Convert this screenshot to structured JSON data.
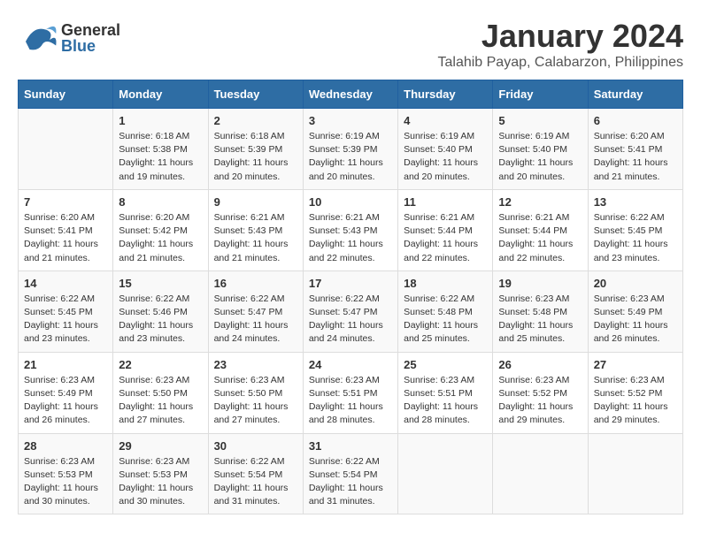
{
  "header": {
    "logo_general": "General",
    "logo_blue": "Blue",
    "title": "January 2024",
    "subtitle": "Talahib Payap, Calabarzon, Philippines"
  },
  "days_of_week": [
    "Sunday",
    "Monday",
    "Tuesday",
    "Wednesday",
    "Thursday",
    "Friday",
    "Saturday"
  ],
  "weeks": [
    [
      {
        "day": "",
        "info": ""
      },
      {
        "day": "1",
        "info": "Sunrise: 6:18 AM\nSunset: 5:38 PM\nDaylight: 11 hours\nand 19 minutes."
      },
      {
        "day": "2",
        "info": "Sunrise: 6:18 AM\nSunset: 5:39 PM\nDaylight: 11 hours\nand 20 minutes."
      },
      {
        "day": "3",
        "info": "Sunrise: 6:19 AM\nSunset: 5:39 PM\nDaylight: 11 hours\nand 20 minutes."
      },
      {
        "day": "4",
        "info": "Sunrise: 6:19 AM\nSunset: 5:40 PM\nDaylight: 11 hours\nand 20 minutes."
      },
      {
        "day": "5",
        "info": "Sunrise: 6:19 AM\nSunset: 5:40 PM\nDaylight: 11 hours\nand 20 minutes."
      },
      {
        "day": "6",
        "info": "Sunrise: 6:20 AM\nSunset: 5:41 PM\nDaylight: 11 hours\nand 21 minutes."
      }
    ],
    [
      {
        "day": "7",
        "info": "Sunrise: 6:20 AM\nSunset: 5:41 PM\nDaylight: 11 hours\nand 21 minutes."
      },
      {
        "day": "8",
        "info": "Sunrise: 6:20 AM\nSunset: 5:42 PM\nDaylight: 11 hours\nand 21 minutes."
      },
      {
        "day": "9",
        "info": "Sunrise: 6:21 AM\nSunset: 5:43 PM\nDaylight: 11 hours\nand 21 minutes."
      },
      {
        "day": "10",
        "info": "Sunrise: 6:21 AM\nSunset: 5:43 PM\nDaylight: 11 hours\nand 22 minutes."
      },
      {
        "day": "11",
        "info": "Sunrise: 6:21 AM\nSunset: 5:44 PM\nDaylight: 11 hours\nand 22 minutes."
      },
      {
        "day": "12",
        "info": "Sunrise: 6:21 AM\nSunset: 5:44 PM\nDaylight: 11 hours\nand 22 minutes."
      },
      {
        "day": "13",
        "info": "Sunrise: 6:22 AM\nSunset: 5:45 PM\nDaylight: 11 hours\nand 23 minutes."
      }
    ],
    [
      {
        "day": "14",
        "info": "Sunrise: 6:22 AM\nSunset: 5:45 PM\nDaylight: 11 hours\nand 23 minutes."
      },
      {
        "day": "15",
        "info": "Sunrise: 6:22 AM\nSunset: 5:46 PM\nDaylight: 11 hours\nand 23 minutes."
      },
      {
        "day": "16",
        "info": "Sunrise: 6:22 AM\nSunset: 5:47 PM\nDaylight: 11 hours\nand 24 minutes."
      },
      {
        "day": "17",
        "info": "Sunrise: 6:22 AM\nSunset: 5:47 PM\nDaylight: 11 hours\nand 24 minutes."
      },
      {
        "day": "18",
        "info": "Sunrise: 6:22 AM\nSunset: 5:48 PM\nDaylight: 11 hours\nand 25 minutes."
      },
      {
        "day": "19",
        "info": "Sunrise: 6:23 AM\nSunset: 5:48 PM\nDaylight: 11 hours\nand 25 minutes."
      },
      {
        "day": "20",
        "info": "Sunrise: 6:23 AM\nSunset: 5:49 PM\nDaylight: 11 hours\nand 26 minutes."
      }
    ],
    [
      {
        "day": "21",
        "info": "Sunrise: 6:23 AM\nSunset: 5:49 PM\nDaylight: 11 hours\nand 26 minutes."
      },
      {
        "day": "22",
        "info": "Sunrise: 6:23 AM\nSunset: 5:50 PM\nDaylight: 11 hours\nand 27 minutes."
      },
      {
        "day": "23",
        "info": "Sunrise: 6:23 AM\nSunset: 5:50 PM\nDaylight: 11 hours\nand 27 minutes."
      },
      {
        "day": "24",
        "info": "Sunrise: 6:23 AM\nSunset: 5:51 PM\nDaylight: 11 hours\nand 28 minutes."
      },
      {
        "day": "25",
        "info": "Sunrise: 6:23 AM\nSunset: 5:51 PM\nDaylight: 11 hours\nand 28 minutes."
      },
      {
        "day": "26",
        "info": "Sunrise: 6:23 AM\nSunset: 5:52 PM\nDaylight: 11 hours\nand 29 minutes."
      },
      {
        "day": "27",
        "info": "Sunrise: 6:23 AM\nSunset: 5:52 PM\nDaylight: 11 hours\nand 29 minutes."
      }
    ],
    [
      {
        "day": "28",
        "info": "Sunrise: 6:23 AM\nSunset: 5:53 PM\nDaylight: 11 hours\nand 30 minutes."
      },
      {
        "day": "29",
        "info": "Sunrise: 6:23 AM\nSunset: 5:53 PM\nDaylight: 11 hours\nand 30 minutes."
      },
      {
        "day": "30",
        "info": "Sunrise: 6:22 AM\nSunset: 5:54 PM\nDaylight: 11 hours\nand 31 minutes."
      },
      {
        "day": "31",
        "info": "Sunrise: 6:22 AM\nSunset: 5:54 PM\nDaylight: 11 hours\nand 31 minutes."
      },
      {
        "day": "",
        "info": ""
      },
      {
        "day": "",
        "info": ""
      },
      {
        "day": "",
        "info": ""
      }
    ]
  ]
}
